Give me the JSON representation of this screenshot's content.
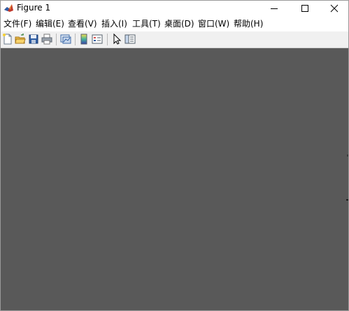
{
  "window": {
    "title": "Figure 1"
  },
  "menu": {
    "items": [
      {
        "label": "文件(F)"
      },
      {
        "label": "编辑(E)"
      },
      {
        "label": "查看(V)"
      },
      {
        "label": "插入(I)"
      },
      {
        "label": "工具(T)"
      },
      {
        "label": "桌面(D)"
      },
      {
        "label": "窗口(W)"
      },
      {
        "label": "帮助(H)"
      }
    ]
  },
  "toolbar": {
    "icons": [
      "new-figure-icon",
      "open-file-icon",
      "save-icon",
      "print-icon",
      "link-plot-icon",
      "insert-colorbar-icon",
      "insert-legend-icon",
      "edit-plot-cursor-icon",
      "property-inspector-icon"
    ]
  },
  "colors": {
    "canvas_background": "#595959",
    "toolbar_background": "#f0f0f0"
  }
}
